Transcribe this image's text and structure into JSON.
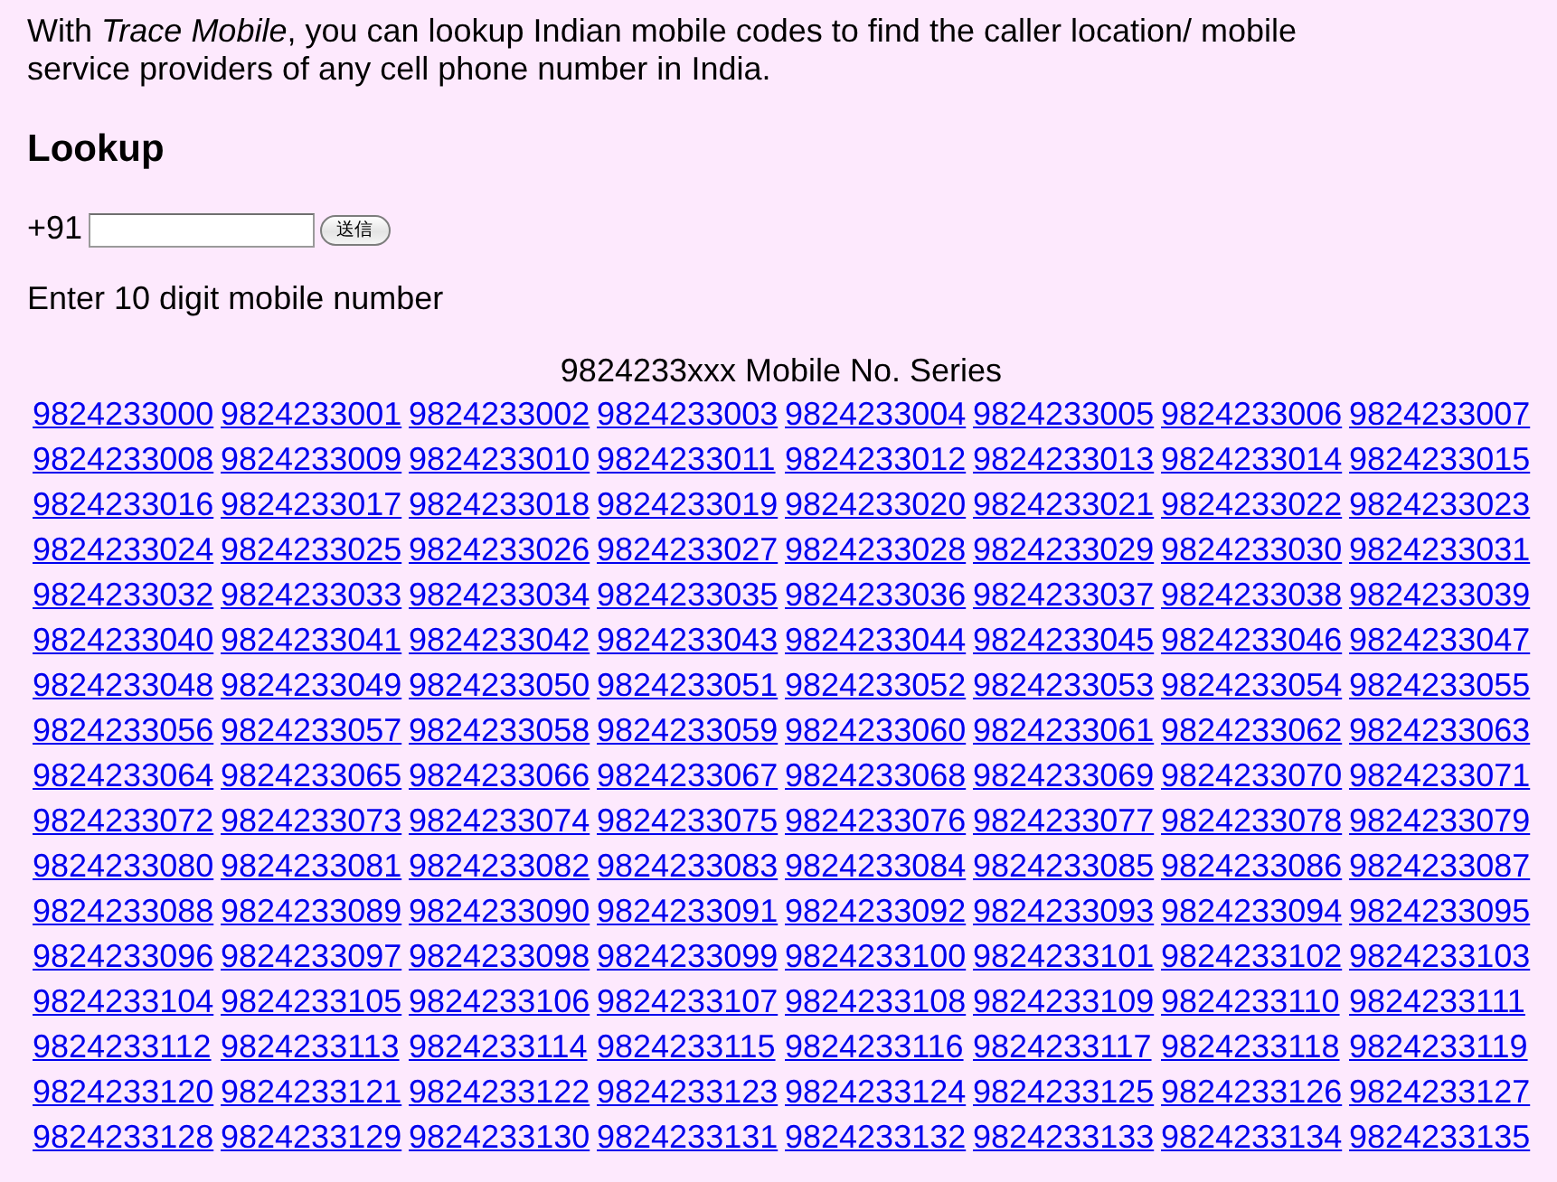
{
  "intro": "With *Trace Mobile*, you can lookup Indian mobile codes to find the caller location/ mobile service providers of any cell phone number in India.",
  "lookup": {
    "heading": "Lookup",
    "prefix": "+91",
    "submit_button": "送信",
    "hint": "Enter 10 digit mobile number"
  },
  "series_table": {
    "caption": "9824233xxx Mobile No. Series",
    "rows": [
      [
        "9824233000",
        "9824233001",
        "9824233002",
        "9824233003",
        "9824233004",
        "9824233005",
        "9824233006",
        "9824233007"
      ],
      [
        "9824233008",
        "9824233009",
        "9824233010",
        "9824233011",
        "9824233012",
        "9824233013",
        "9824233014",
        "9824233015"
      ],
      [
        "9824233016",
        "9824233017",
        "9824233018",
        "9824233019",
        "9824233020",
        "9824233021",
        "9824233022",
        "9824233023"
      ],
      [
        "9824233024",
        "9824233025",
        "9824233026",
        "9824233027",
        "9824233028",
        "9824233029",
        "9824233030",
        "9824233031"
      ],
      [
        "9824233032",
        "9824233033",
        "9824233034",
        "9824233035",
        "9824233036",
        "9824233037",
        "9824233038",
        "9824233039"
      ],
      [
        "9824233040",
        "9824233041",
        "9824233042",
        "9824233043",
        "9824233044",
        "9824233045",
        "9824233046",
        "9824233047"
      ],
      [
        "9824233048",
        "9824233049",
        "9824233050",
        "9824233051",
        "9824233052",
        "9824233053",
        "9824233054",
        "9824233055"
      ],
      [
        "9824233056",
        "9824233057",
        "9824233058",
        "9824233059",
        "9824233060",
        "9824233061",
        "9824233062",
        "9824233063"
      ],
      [
        "9824233064",
        "9824233065",
        "9824233066",
        "9824233067",
        "9824233068",
        "9824233069",
        "9824233070",
        "9824233071"
      ],
      [
        "9824233072",
        "9824233073",
        "9824233074",
        "9824233075",
        "9824233076",
        "9824233077",
        "9824233078",
        "9824233079"
      ],
      [
        "9824233080",
        "9824233081",
        "9824233082",
        "9824233083",
        "9824233084",
        "9824233085",
        "9824233086",
        "9824233087"
      ],
      [
        "9824233088",
        "9824233089",
        "9824233090",
        "9824233091",
        "9824233092",
        "9824233093",
        "9824233094",
        "9824233095"
      ],
      [
        "9824233096",
        "9824233097",
        "9824233098",
        "9824233099",
        "9824233100",
        "9824233101",
        "9824233102",
        "9824233103"
      ],
      [
        "9824233104",
        "9824233105",
        "9824233106",
        "9824233107",
        "9824233108",
        "9824233109",
        "9824233110",
        "9824233111"
      ],
      [
        "9824233112",
        "9824233113",
        "9824233114",
        "9824233115",
        "9824233116",
        "9824233117",
        "9824233118",
        "9824233119"
      ],
      [
        "9824233120",
        "9824233121",
        "9824233122",
        "9824233123",
        "9824233124",
        "9824233125",
        "9824233126",
        "9824233127"
      ],
      [
        "9824233128",
        "9824233129",
        "9824233130",
        "9824233131",
        "9824233132",
        "9824233133",
        "9824233134",
        "9824233135"
      ]
    ]
  }
}
